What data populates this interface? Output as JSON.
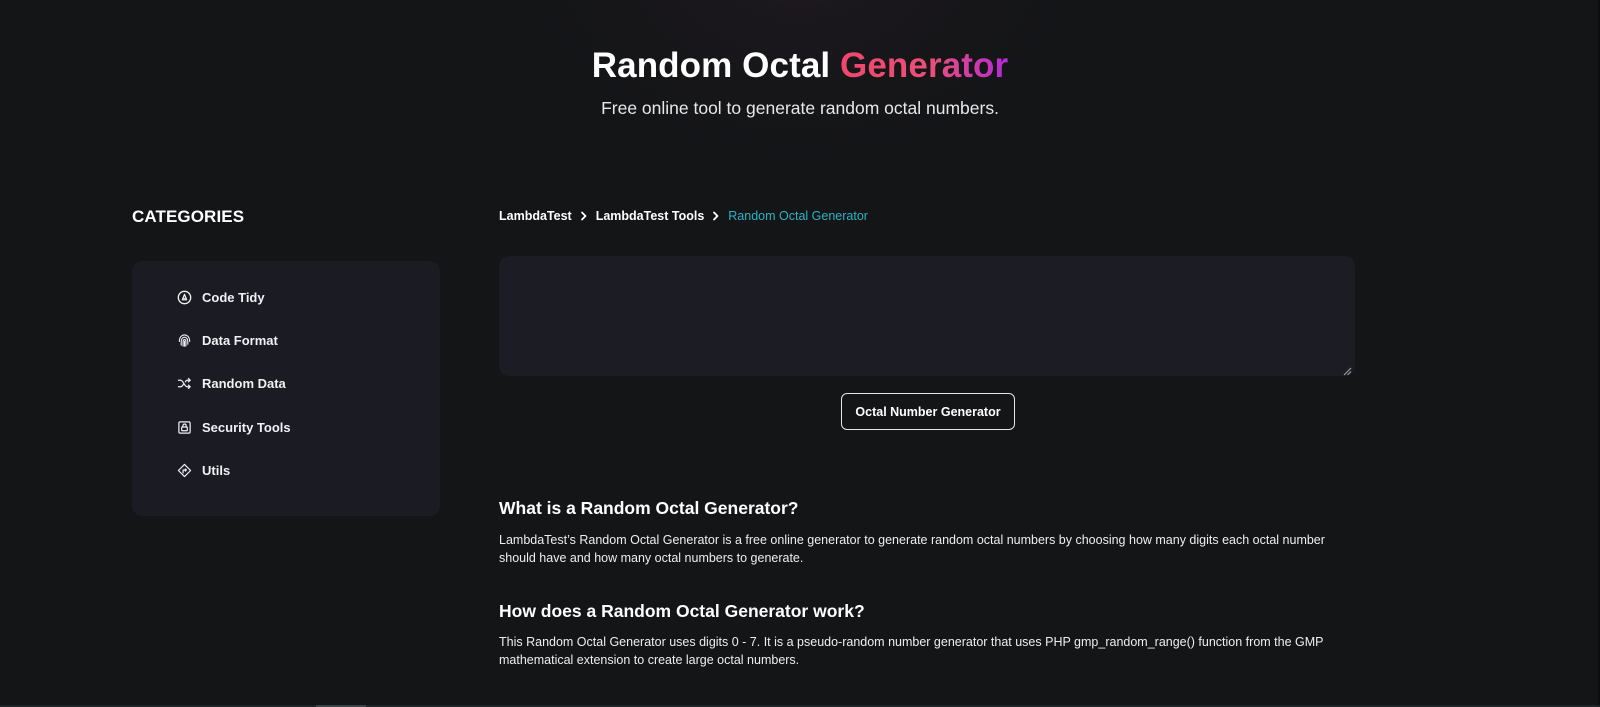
{
  "hero": {
    "title_plain": "Random Octal ",
    "title_accent": "Generator",
    "subtitle": "Free online tool to generate random octal numbers."
  },
  "sidebar": {
    "heading": "CATEGORIES",
    "items": [
      {
        "label": "Code Tidy",
        "icon": "code-tidy-icon"
      },
      {
        "label": "Data Format",
        "icon": "fingerprint-icon"
      },
      {
        "label": "Random Data",
        "icon": "shuffle-icon"
      },
      {
        "label": "Security Tools",
        "icon": "lock-icon"
      },
      {
        "label": "Utils",
        "icon": "direction-sign-icon"
      }
    ]
  },
  "breadcrumb": {
    "items": [
      "LambdaTest",
      "LambdaTest Tools",
      "Random Octal Generator"
    ]
  },
  "tool": {
    "output_value": "",
    "button_label": "Octal Number Generator"
  },
  "content": {
    "sections": [
      {
        "heading": "What is a Random Octal Generator?",
        "body": "LambdaTest’s Random Octal Generator is a free online generator to generate random octal numbers by choosing how many digits each octal number should have and how many octal numbers to generate."
      },
      {
        "heading": "How does a Random Octal Generator work?",
        "body": "This Random Octal Generator uses digits 0 - 7. It is a pseudo-random number generator that uses PHP gmp_random_range() function from the GMP mathematical extension to create large octal numbers."
      }
    ]
  },
  "colors": {
    "background": "#141517",
    "panel": "#1a1b23",
    "accent_start": "#f0476a",
    "accent_end": "#b62ad6",
    "breadcrumb_current": "#2bb3c4"
  }
}
